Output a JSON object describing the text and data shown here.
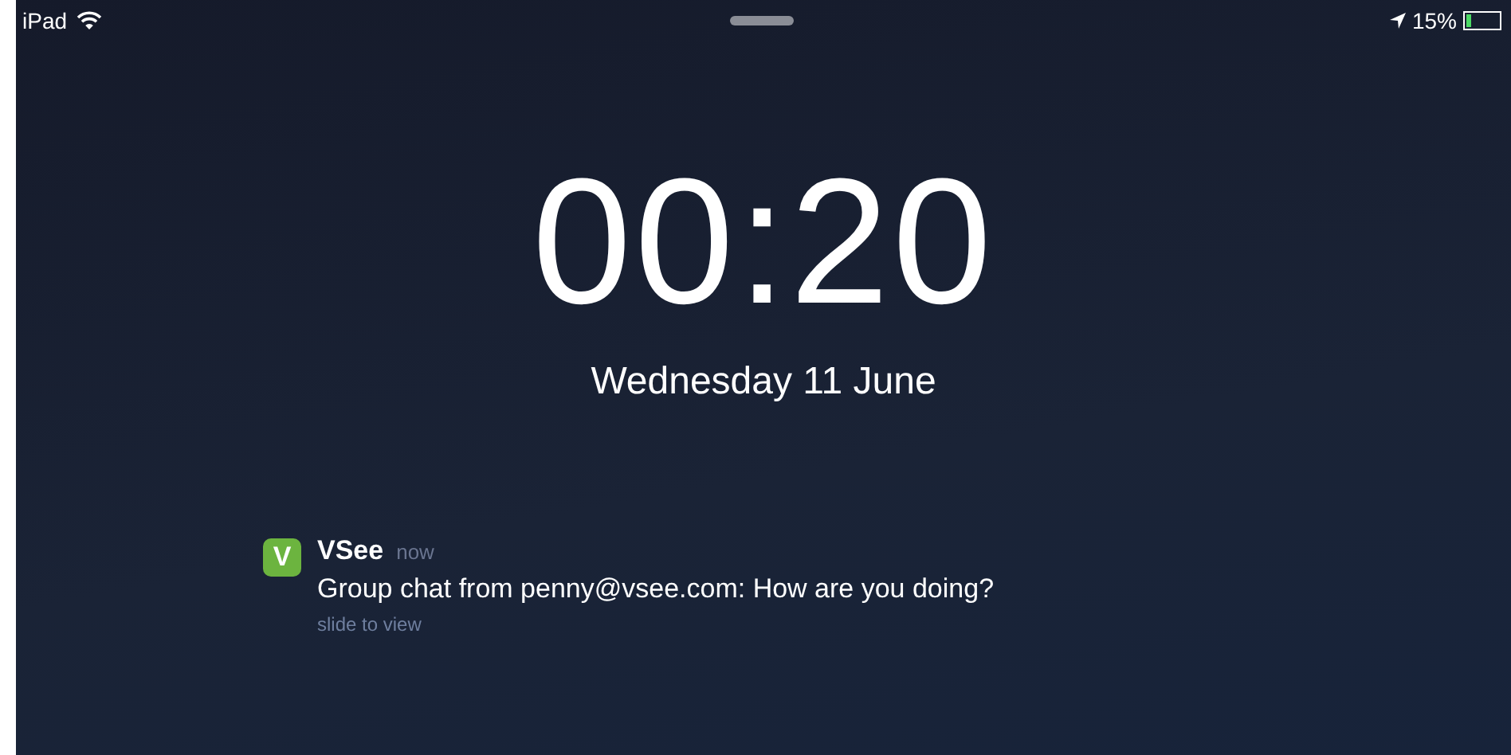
{
  "status_bar": {
    "device": "iPad",
    "battery": "15%"
  },
  "clock": {
    "time": "00:20",
    "date": "Wednesday 11 June"
  },
  "notification": {
    "app_icon_letter": "V",
    "app": "VSee",
    "time": "now",
    "message": "Group chat from penny@vsee.com: How are you doing?",
    "hint": "slide to view"
  }
}
